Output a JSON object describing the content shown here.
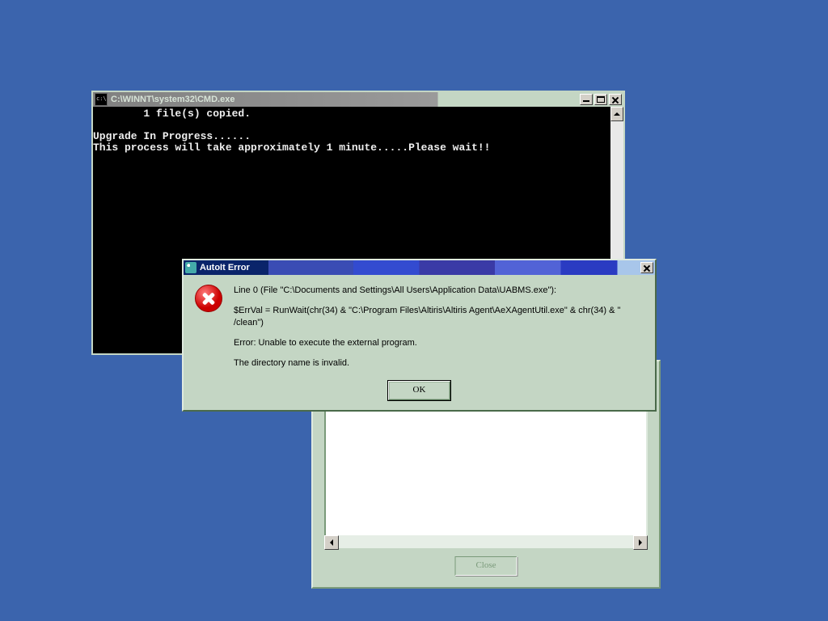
{
  "cmd": {
    "title": "C:\\WINNT\\system32\\CMD.exe",
    "line1": "        1 file(s) copied.",
    "line2": "",
    "line3": "Upgrade In Progress......",
    "line4": "This process will take approximately 1 minute.....Please wait!!"
  },
  "autoit": {
    "title": "AutoIt Error",
    "line1": "Line 0  (File \"C:\\Documents and Settings\\All Users\\Application Data\\UABMS.exe\"):",
    "line2": "$ErrVal = RunWait(chr(34) & \"C:\\Program Files\\Altiris\\Altiris Agent\\AeXAgentUtil.exe\" & chr(34) & \" /clean\")",
    "line3": "Error: Unable to execute the external program.",
    "line4": "The directory name is invalid.",
    "ok": "OK"
  },
  "panel": {
    "close": "Close"
  }
}
